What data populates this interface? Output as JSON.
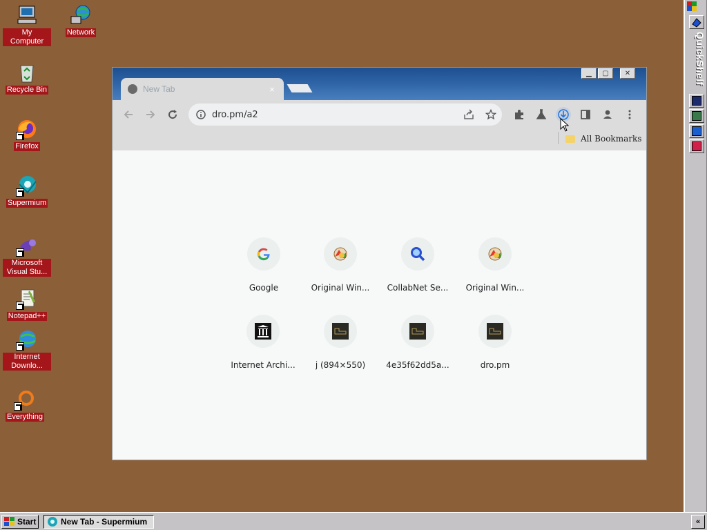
{
  "desktop": {
    "icons": [
      {
        "label": "My Computer",
        "icon": "computer-icon"
      },
      {
        "label": "Network",
        "icon": "network-icon"
      },
      {
        "label": "Recycle Bin",
        "icon": "recycle-bin-icon"
      },
      {
        "label": "Firefox",
        "icon": "firefox-icon"
      },
      {
        "label": "Supermium",
        "icon": "supermium-icon"
      },
      {
        "label": "Microsoft Visual Stu...",
        "icon": "visual-studio-icon"
      },
      {
        "label": "Notepad++",
        "icon": "notepadpp-icon"
      },
      {
        "label": "Internet Downlo...",
        "icon": "internet-download-icon"
      },
      {
        "label": "Everything",
        "icon": "everything-icon"
      }
    ]
  },
  "quickshelf": {
    "title": "QuickShelf"
  },
  "taskbar": {
    "start_label": "Start",
    "tasks": [
      {
        "label": "New Tab - Supermium"
      }
    ],
    "tray_label": "«"
  },
  "browser": {
    "tab": {
      "title": "New Tab",
      "close": "×"
    },
    "window_controls": {
      "minimize": "▁",
      "maximize": "▢",
      "close": "✕"
    },
    "address_bar": {
      "value": "dro.pm/a2"
    },
    "bookmarks": {
      "all_label": "All Bookmarks"
    },
    "shortcuts": [
      {
        "label": "Google",
        "icon": "google-icon"
      },
      {
        "label": "Original Win...",
        "icon": "original-win-icon"
      },
      {
        "label": "CollabNet Se...",
        "icon": "search-icon"
      },
      {
        "label": "Original Win...",
        "icon": "original-win-icon"
      },
      {
        "label": "Internet Archi...",
        "icon": "internet-archive-icon"
      },
      {
        "label": "j (894×550)",
        "icon": "thumbnail-icon"
      },
      {
        "label": "4e35f62dd5a...",
        "icon": "thumbnail-icon"
      },
      {
        "label": "dro.pm",
        "icon": "thumbnail-icon"
      }
    ]
  },
  "colors": {
    "desktop_bg": "#8b6039",
    "icon_label_bg": "#a4161a",
    "titlebar_blue": "#2f66a8",
    "chrome_gray": "#dcdcdc",
    "page_bg": "#f7f9f8"
  }
}
